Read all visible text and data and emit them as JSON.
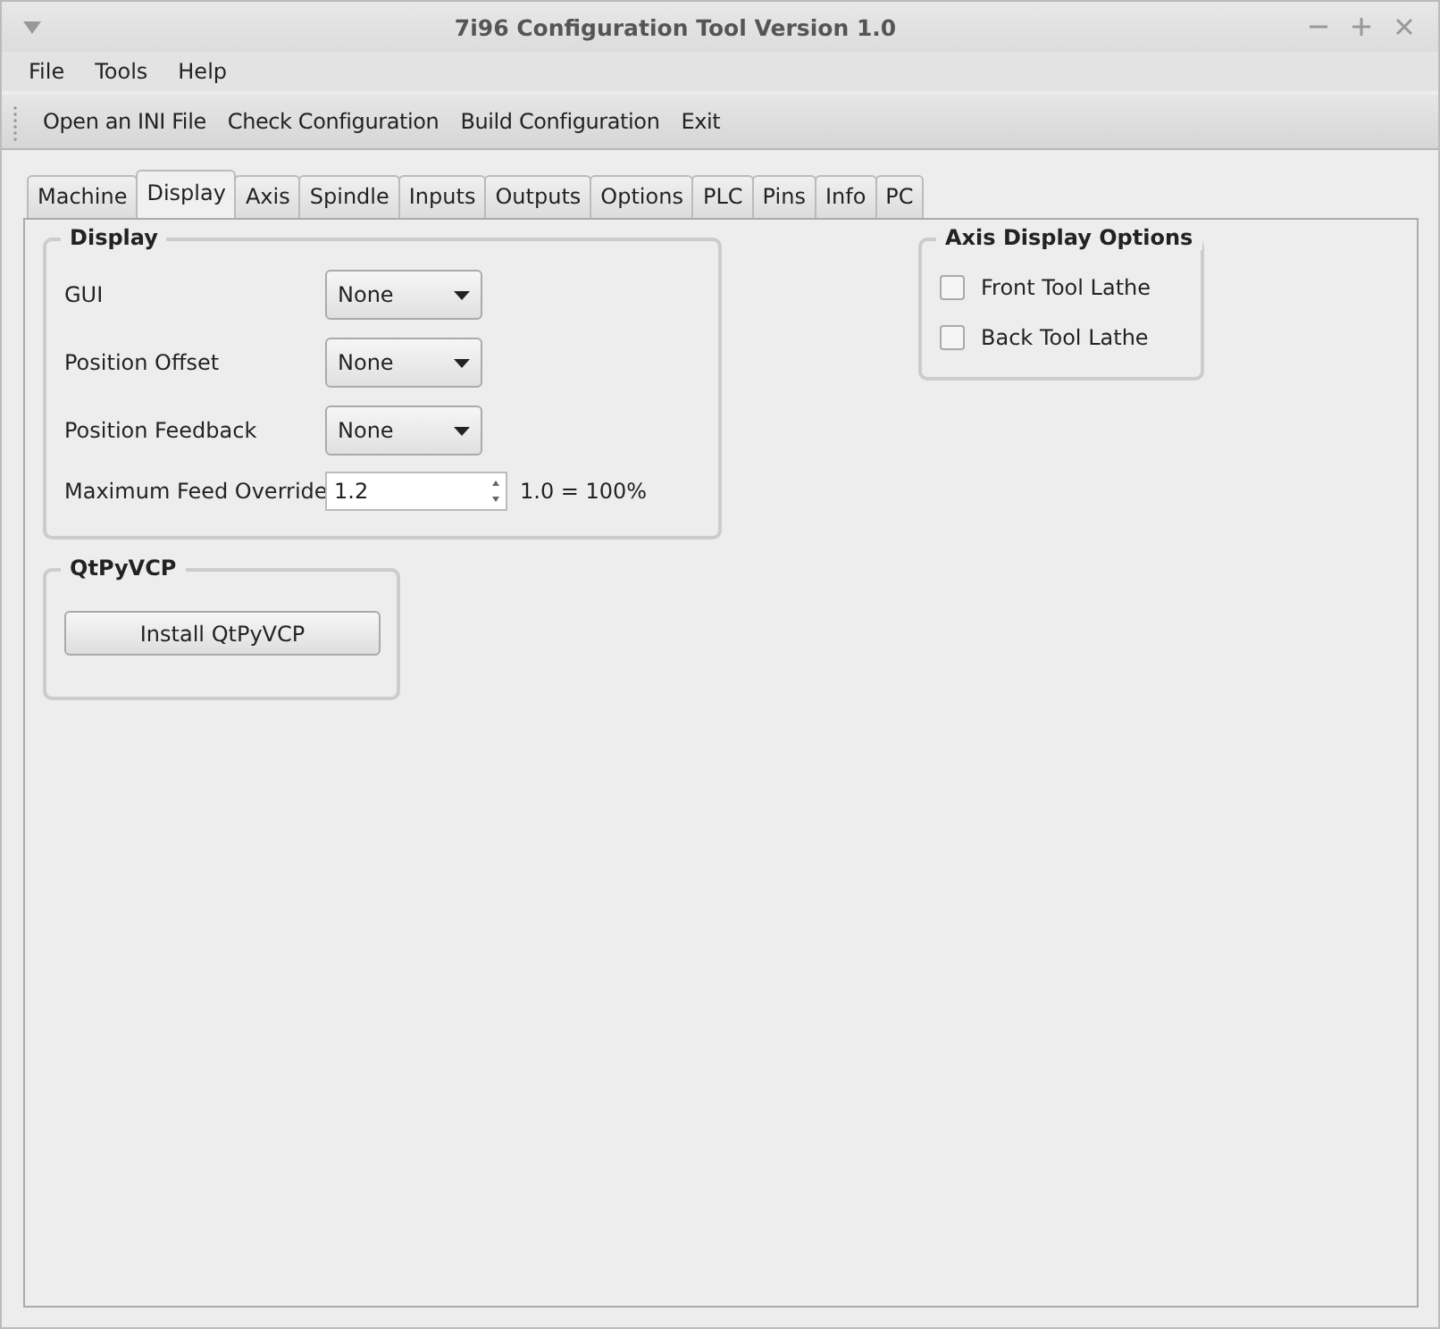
{
  "window": {
    "title": "7i96 Configuration Tool Version 1.0"
  },
  "menu": [
    "File",
    "Tools",
    "Help"
  ],
  "toolbar": [
    "Open an INI File",
    "Check Configuration",
    "Build Configuration",
    "Exit"
  ],
  "tabs": [
    {
      "label": "Machine",
      "selected": false
    },
    {
      "label": "Display",
      "selected": true
    },
    {
      "label": "Axis",
      "selected": false
    },
    {
      "label": "Spindle",
      "selected": false
    },
    {
      "label": "Inputs",
      "selected": false
    },
    {
      "label": "Outputs",
      "selected": false
    },
    {
      "label": "Options",
      "selected": false
    },
    {
      "label": "PLC",
      "selected": false
    },
    {
      "label": "Pins",
      "selected": false
    },
    {
      "label": "Info",
      "selected": false
    },
    {
      "label": "PC",
      "selected": false
    }
  ],
  "display_group": {
    "title": "Display",
    "fields": [
      {
        "kind": "combo",
        "label": "GUI",
        "value": "None"
      },
      {
        "kind": "combo",
        "label": "Position Offset",
        "value": "None"
      },
      {
        "kind": "combo",
        "label": "Position Feedback",
        "value": "None"
      },
      {
        "kind": "spin",
        "label": "Maximum Feed Override",
        "value": "1.2",
        "note": "1.0 = 100%"
      }
    ]
  },
  "qtpyvcp_group": {
    "title": "QtPyVCP",
    "button": "Install QtPyVCP"
  },
  "axis_display_group": {
    "title": "Axis Display Options",
    "options": [
      {
        "label": "Front Tool Lathe",
        "checked": false
      },
      {
        "label": "Back Tool Lathe",
        "checked": false
      }
    ]
  }
}
